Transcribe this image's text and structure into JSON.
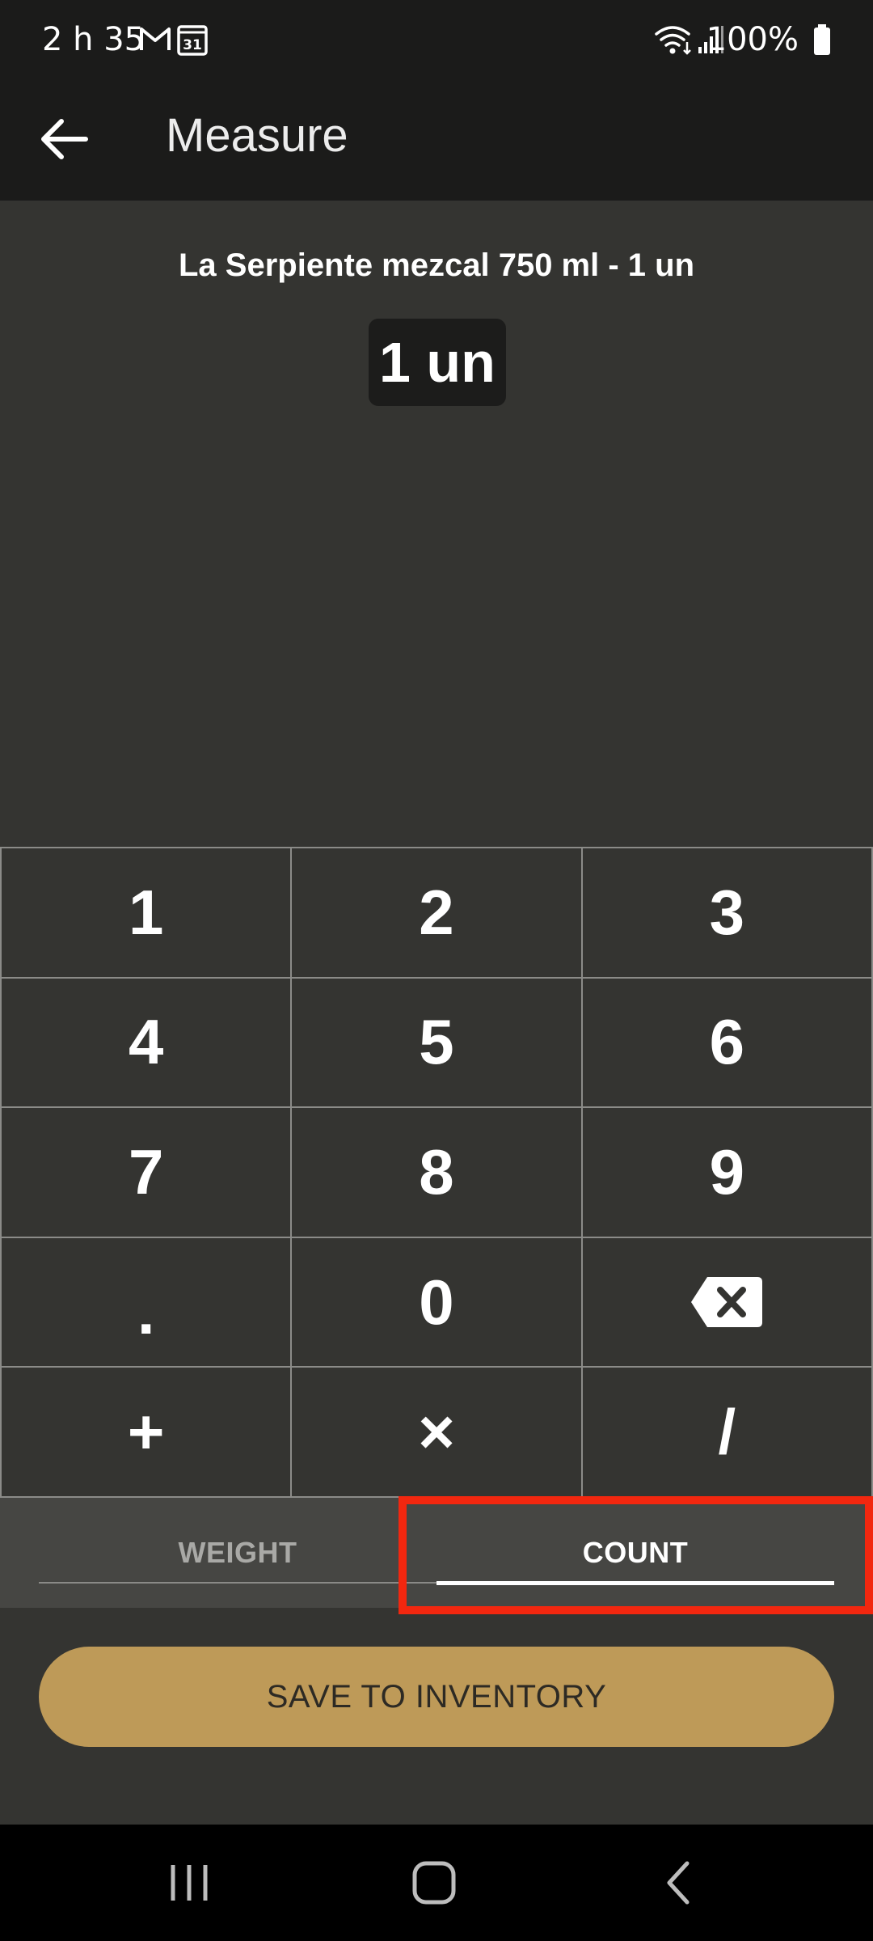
{
  "status_bar": {
    "time": "2 h 35",
    "battery": "100%",
    "calendar_day": "31",
    "icons": [
      "gmail-icon",
      "calendar-icon",
      "wifi-icon",
      "signal-icon",
      "battery-icon"
    ]
  },
  "app_bar": {
    "title": "Measure",
    "back_icon": "arrow-left-icon"
  },
  "item": {
    "name": "La Serpiente mezcal 750 ml - 1 un",
    "display_value": "1 un"
  },
  "keypad": {
    "keys": [
      "1",
      "2",
      "3",
      "4",
      "5",
      "6",
      "7",
      "8",
      "9",
      ".",
      "0",
      "backspace",
      "+",
      "×",
      "/"
    ],
    "backspace_icon": "backspace-icon"
  },
  "tabs": {
    "weight": "WEIGHT",
    "count": "COUNT",
    "selected": "COUNT"
  },
  "save_button": {
    "label": "SAVE TO INVENTORY"
  },
  "colors": {
    "background": "#343431",
    "bar": "#1b1b1a",
    "accent": "#be9a58",
    "highlight": "#f2270f"
  },
  "nav_bar": {
    "icons": [
      "recent-apps-icon",
      "home-icon",
      "back-nav-icon"
    ]
  }
}
